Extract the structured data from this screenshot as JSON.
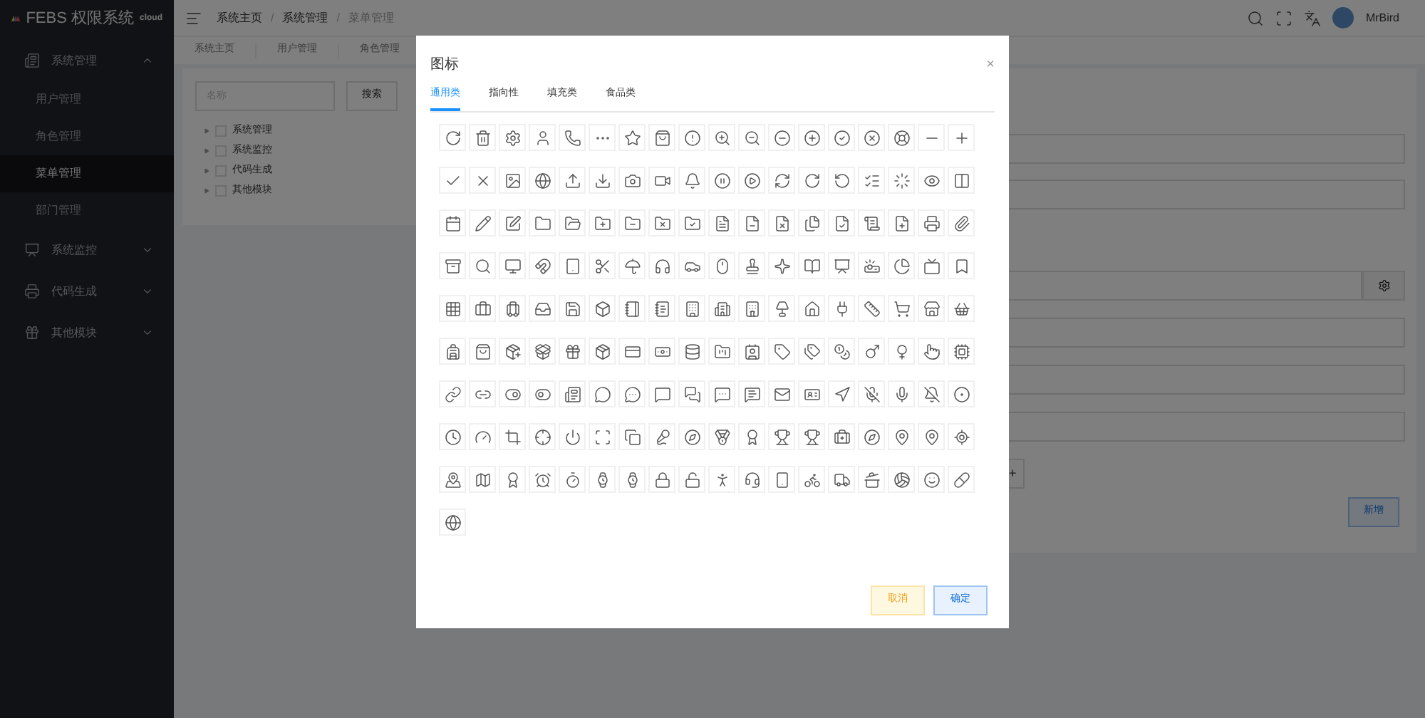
{
  "sidebar": {
    "logo_text": "FEBS 权限系统",
    "logo_badge": "cloud",
    "items": [
      {
        "label": "系统管理",
        "expanded": true,
        "children": [
          {
            "label": "用户管理",
            "selected": false
          },
          {
            "label": "角色管理",
            "selected": false
          },
          {
            "label": "菜单管理",
            "selected": true
          },
          {
            "label": "部门管理",
            "selected": false
          }
        ]
      },
      {
        "label": "系统监控",
        "expanded": false
      },
      {
        "label": "代码生成",
        "expanded": false
      },
      {
        "label": "其他模块",
        "expanded": false
      }
    ]
  },
  "header": {
    "breadcrumbs": [
      "系统主页",
      "系统管理",
      "菜单管理"
    ],
    "separator": "/",
    "user": "MrBird"
  },
  "page_tabs": [
    {
      "label": "系统主页"
    },
    {
      "label": "用户管理"
    },
    {
      "label": "角色管理"
    }
  ],
  "menu_panel": {
    "search_placeholder": "名称",
    "search_button": "搜索",
    "tree": [
      {
        "label": "系统管理",
        "checked": false
      },
      {
        "label": "系统监控",
        "checked": false
      },
      {
        "label": "代码生成",
        "checked": false
      },
      {
        "label": "其他模块",
        "checked": false
      }
    ]
  },
  "form_panel": {
    "plus_button": "+",
    "add_button": "新增"
  },
  "dialog": {
    "title": "图标",
    "close": "×",
    "tabs": [
      {
        "label": "通用类",
        "selected": true
      },
      {
        "label": "指向性",
        "selected": false
      },
      {
        "label": "填充类",
        "selected": false
      },
      {
        "label": "食品类",
        "selected": false
      }
    ],
    "buttons": [
      {
        "label": "取消",
        "kind": "cancel"
      },
      {
        "label": "确定",
        "kind": "confirm"
      }
    ]
  }
}
